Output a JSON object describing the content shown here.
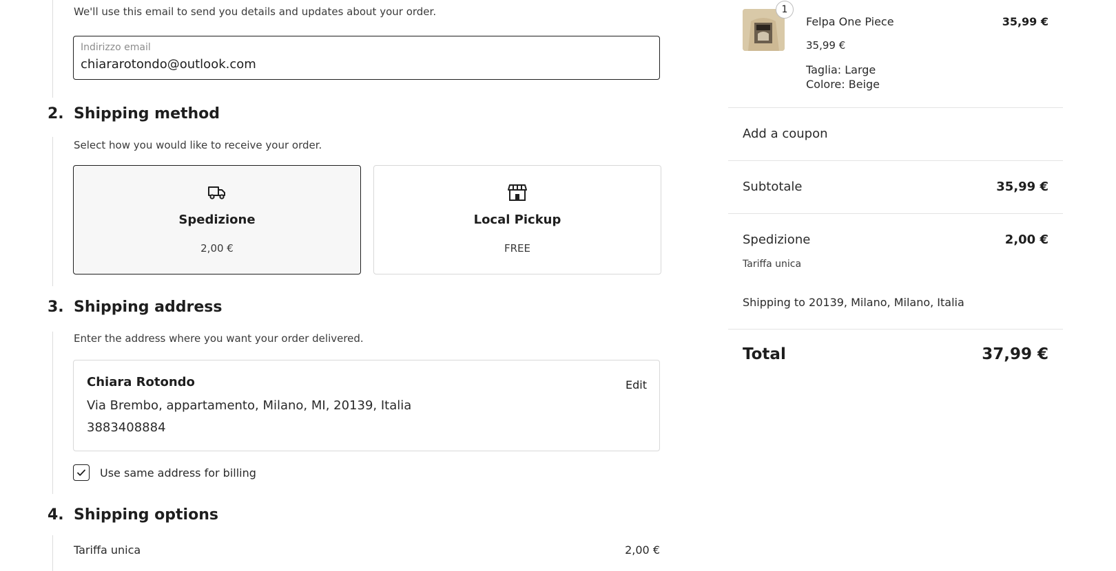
{
  "contact": {
    "helper": "We'll use this email to send you details and updates about your order.",
    "email_label": "Indirizzo email",
    "email_value": "chiararotondo@outlook.com"
  },
  "shipping_method": {
    "number": "2.",
    "title": "Shipping method",
    "helper": "Select how you would like to receive your order.",
    "options": [
      {
        "label": "Spedizione",
        "price": "2,00 €",
        "icon": "truck-icon",
        "selected": true
      },
      {
        "label": "Local Pickup",
        "price": "FREE",
        "icon": "store-icon",
        "selected": false
      }
    ]
  },
  "shipping_address": {
    "number": "3.",
    "title": "Shipping address",
    "helper": "Enter the address where you want your order delivered.",
    "name": "Chiara Rotondo",
    "address": "Via Brembo, appartamento, Milano, MI, 20139, Italia",
    "phone": "3883408884",
    "edit_label": "Edit",
    "billing_label": "Use same address for billing",
    "billing_checked": true
  },
  "shipping_options": {
    "number": "4.",
    "title": "Shipping options",
    "rate_name": "Tariffa unica",
    "rate_price": "2,00 €"
  },
  "summary": {
    "item": {
      "quantity": "1",
      "name": "Felpa One Piece",
      "unit_price": "35,99 €",
      "size": "Taglia: Large",
      "color": "Colore: Beige",
      "line_total": "35,99 €"
    },
    "coupon_label": "Add a coupon",
    "subtotal_label": "Subtotale",
    "subtotal_value": "35,99 €",
    "shipping_label": "Spedizione",
    "shipping_value": "2,00 €",
    "shipping_rate": "Tariffa unica",
    "shipping_to": "Shipping to 20139, Milano, Milano, Italia",
    "total_label": "Total",
    "total_value": "37,99 €"
  }
}
